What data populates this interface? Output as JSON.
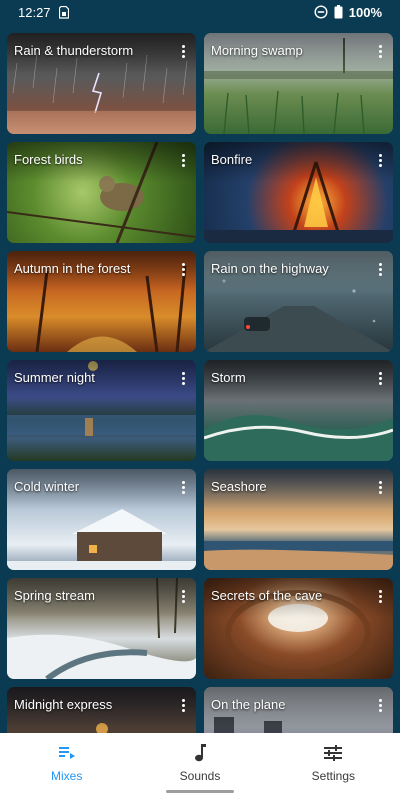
{
  "status_bar": {
    "time": "12:27",
    "battery": "100%",
    "icons": [
      "sim-card-icon",
      "do-not-disturb-icon",
      "battery-icon"
    ]
  },
  "mixes": [
    {
      "title": "Rain & thunderstorm",
      "scene": "rain"
    },
    {
      "title": "Morning swamp",
      "scene": "swamp"
    },
    {
      "title": "Forest birds",
      "scene": "birds"
    },
    {
      "title": "Bonfire",
      "scene": "bonfire"
    },
    {
      "title": "Autumn in the forest",
      "scene": "autumn"
    },
    {
      "title": "Rain on the highway",
      "scene": "highway"
    },
    {
      "title": "Summer night",
      "scene": "summer"
    },
    {
      "title": "Storm",
      "scene": "storm"
    },
    {
      "title": "Cold winter",
      "scene": "winter"
    },
    {
      "title": "Seashore",
      "scene": "seashore"
    },
    {
      "title": "Spring stream",
      "scene": "spring"
    },
    {
      "title": "Secrets of the cave",
      "scene": "cave"
    },
    {
      "title": "Midnight express",
      "scene": "express"
    },
    {
      "title": "On the plane",
      "scene": "plane"
    }
  ],
  "bottom_nav": {
    "items": [
      {
        "label": "Mixes",
        "icon": "playlist-icon",
        "active": true
      },
      {
        "label": "Sounds",
        "icon": "music-note-icon",
        "active": false
      },
      {
        "label": "Settings",
        "icon": "sliders-icon",
        "active": false
      }
    ],
    "active_color": "#2196f3"
  },
  "colors": {
    "background": "#0b3a53"
  }
}
